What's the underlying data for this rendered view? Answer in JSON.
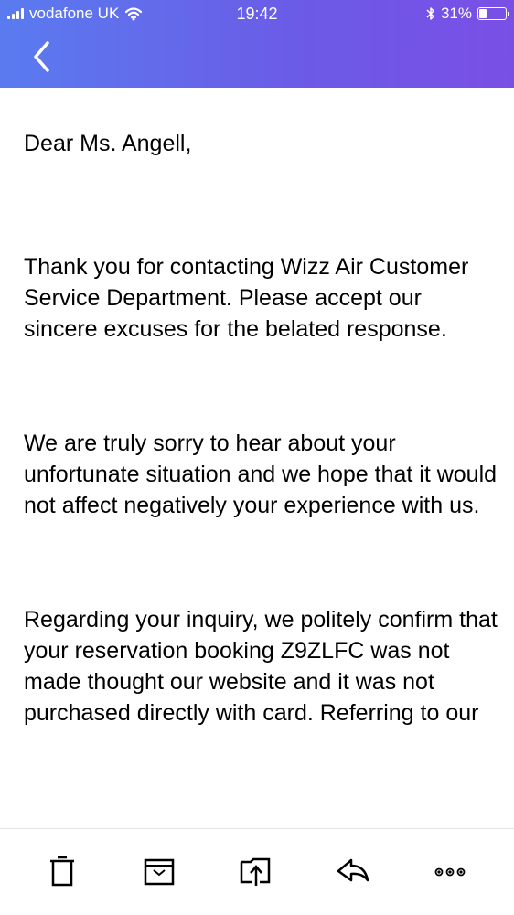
{
  "status_bar": {
    "carrier": "vodafone UK",
    "time": "19:42",
    "battery_percent": "31%",
    "battery_level": 0.31,
    "icons": [
      "signal-icon",
      "wifi-icon",
      "bluetooth-icon",
      "battery-icon"
    ]
  },
  "header": {
    "back_icon": "chevron-left-icon",
    "accent_color": "#6a5ae8"
  },
  "email": {
    "greeting": "Dear Ms. Angell,",
    "paragraphs": [
      "Thank you for contacting Wizz Air Customer Service Department. Please accept our sincere excuses for the belated response.",
      "We are truly sorry to hear about your unfortunate situation and we hope that it would not affect negatively your experience with us.",
      "Regarding your inquiry, we politely confirm that your reservation booking Z9ZLFC was not made thought our website and it was not purchased directly with card. Referring to our"
    ]
  },
  "toolbar": {
    "icons": [
      "trash-icon",
      "archive-icon",
      "move-icon",
      "reply-icon",
      "more-icon"
    ]
  }
}
